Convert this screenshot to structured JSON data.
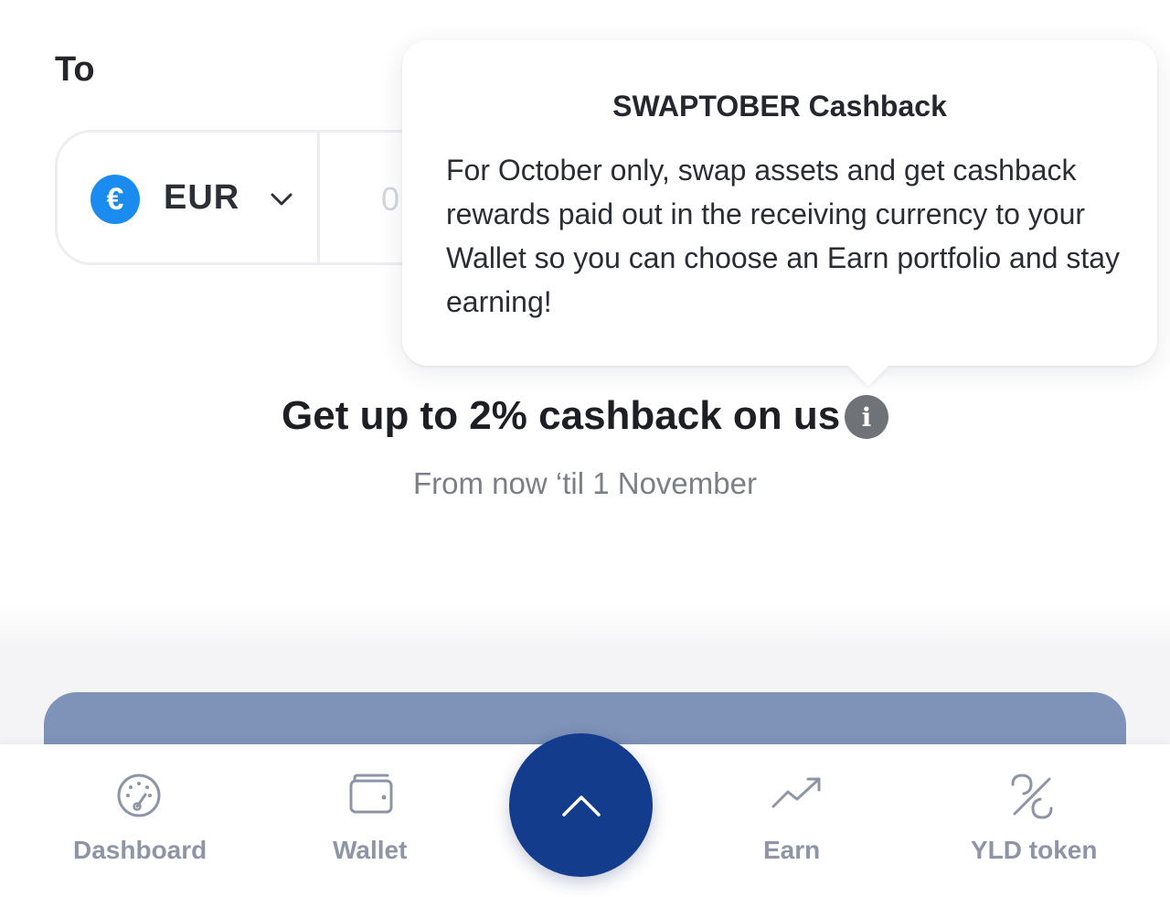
{
  "swap": {
    "to_label": "To",
    "currency_symbol": "€",
    "currency_code": "EUR",
    "amount_placeholder": "0"
  },
  "tooltip": {
    "title": "SWAPTOBER Cashback",
    "body": "For October only, swap assets and get cashback rewards paid out in the receiving currency to your Wallet so you can choose an Earn portfolio and stay earning!"
  },
  "promo": {
    "headline": "Get up to 2% cashback on us",
    "subline": "From now ‘til 1 November",
    "info_icon": "i"
  },
  "nav": {
    "items": [
      {
        "label": "Dashboard",
        "icon": "dashboard-gauge-icon"
      },
      {
        "label": "Wallet",
        "icon": "wallet-icon"
      },
      {
        "label": "Earn",
        "icon": "trending-up-icon"
      },
      {
        "label": "YLD token",
        "icon": "yld-token-icon"
      }
    ],
    "center_button_icon": "chevron-up-icon"
  },
  "colors": {
    "accent_blue": "#143c8c",
    "euro_blue": "#1a8cf0",
    "card_blue": "#7f93b8",
    "nav_grey": "#8d95a6"
  }
}
